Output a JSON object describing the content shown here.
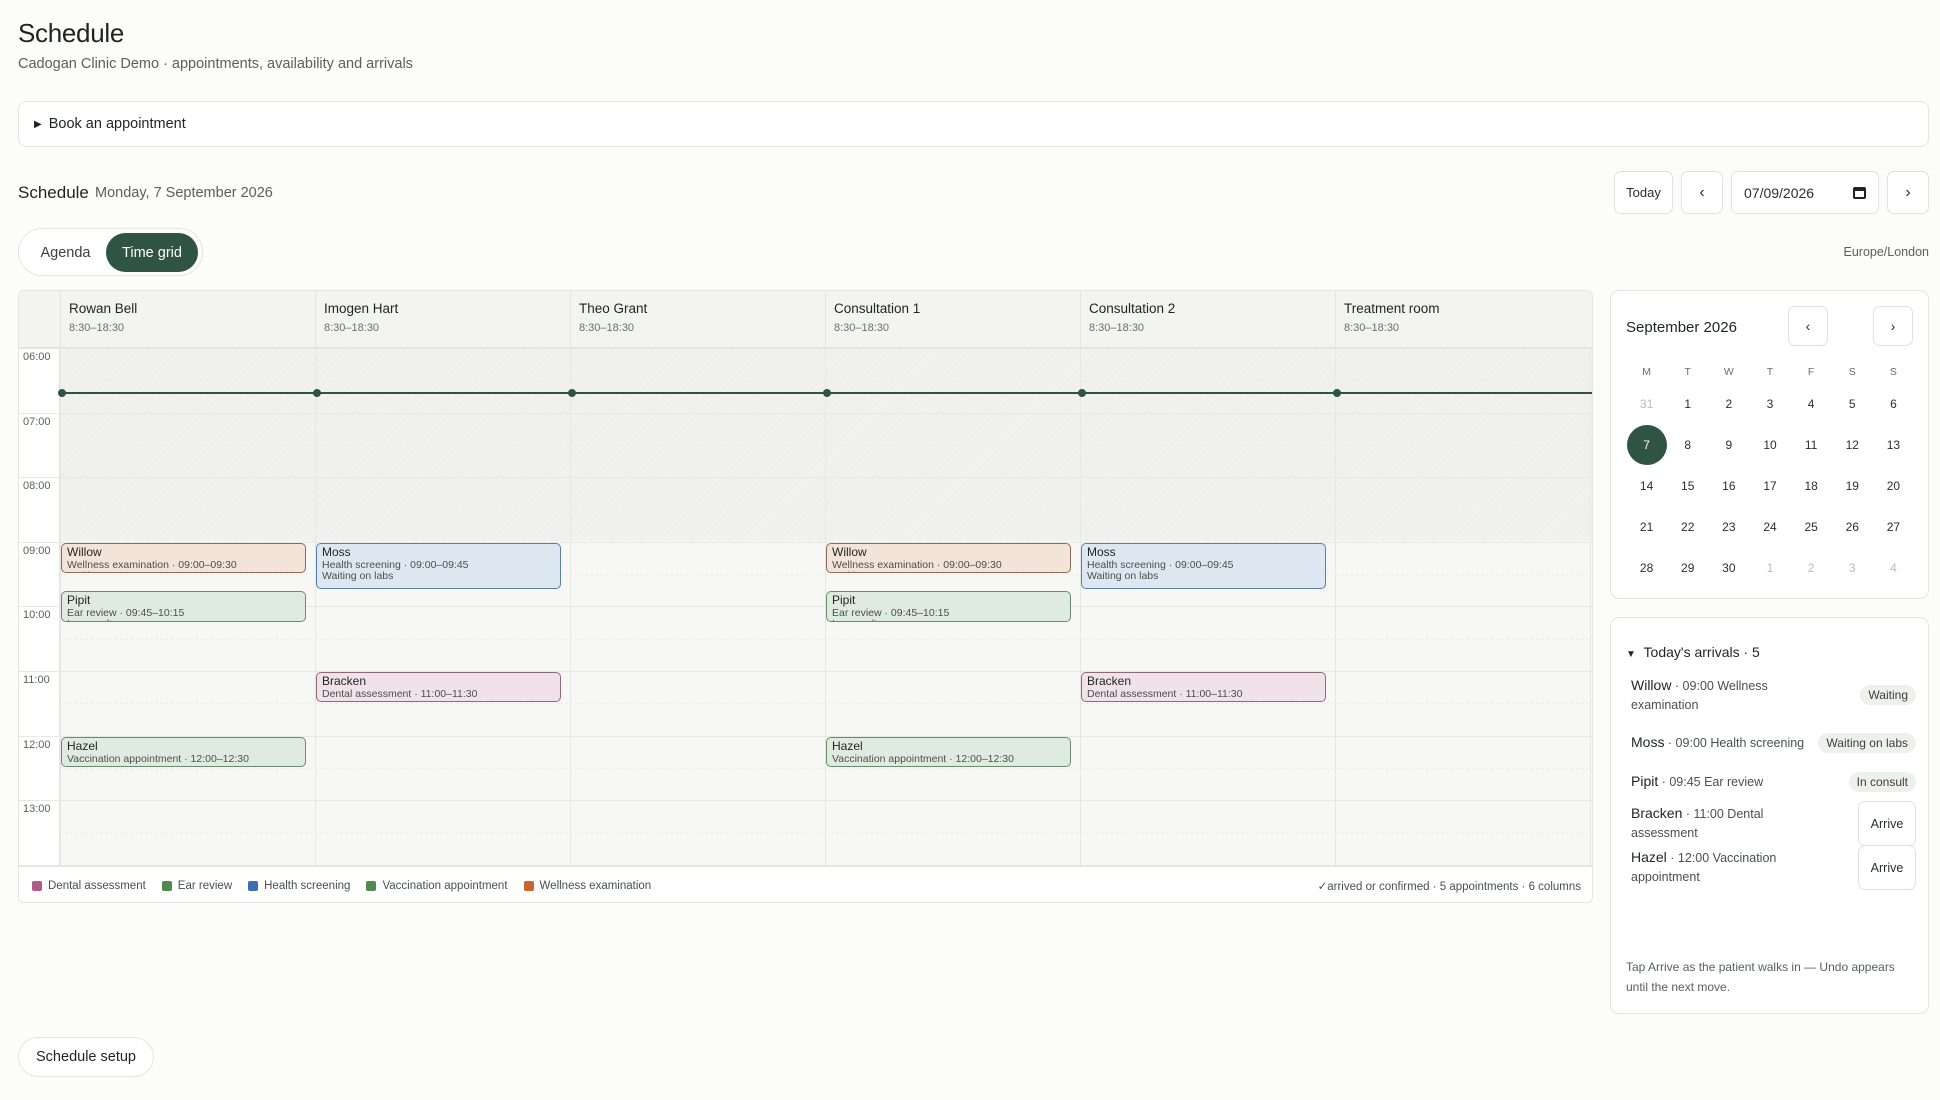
{
  "page": {
    "title": "Schedule",
    "subtitle": "Cadogan Clinic Demo · appointments, availability and arrivals"
  },
  "book": {
    "label": "Book an appointment"
  },
  "schedule": {
    "title": "Schedule",
    "date_label": "Monday, 7 September 2026",
    "timezone": "Europe/London"
  },
  "toolbar": {
    "today": "Today",
    "prev": "‹",
    "next": "›",
    "date_value": "07/09/2026"
  },
  "views": {
    "agenda": "Agenda",
    "time_grid": "Time grid",
    "active": "Time grid"
  },
  "columns": [
    {
      "name": "Rowan Bell",
      "hours": "8:30–18:30"
    },
    {
      "name": "Imogen Hart",
      "hours": "8:30–18:30"
    },
    {
      "name": "Theo Grant",
      "hours": "8:30–18:30"
    },
    {
      "name": "Consultation 1",
      "hours": "8:30–18:30"
    },
    {
      "name": "Consultation 2",
      "hours": "8:30–18:30"
    },
    {
      "name": "Treatment room",
      "hours": "8:30–18:30"
    }
  ],
  "hours": [
    "06:00",
    "07:00",
    "08:00",
    "09:00",
    "10:00",
    "11:00",
    "12:00",
    "13:00"
  ],
  "appointments": [
    {
      "column": 0,
      "name": "Willow",
      "detail": "Wellness examination · 09:00–09:30",
      "note": "Waiting",
      "start": "09:00",
      "end": "09:30",
      "type": "well"
    },
    {
      "column": 0,
      "name": "Pipit",
      "detail": "Ear review · 09:45–10:15",
      "note": "In consult",
      "start": "09:45",
      "end": "10:15",
      "type": "ear"
    },
    {
      "column": 0,
      "name": "Hazel",
      "detail": "Vaccination appointment · 12:00–12:30",
      "note": "",
      "start": "12:00",
      "end": "12:30",
      "type": "vacc"
    },
    {
      "column": 1,
      "name": "Moss",
      "detail": "Health screening · 09:00–09:45",
      "note": "Waiting on labs",
      "start": "09:00",
      "end": "09:45",
      "type": "health"
    },
    {
      "column": 1,
      "name": "Bracken",
      "detail": "Dental assessment · 11:00–11:30",
      "note": "",
      "start": "11:00",
      "end": "11:30",
      "type": "dental"
    },
    {
      "column": 3,
      "name": "Willow",
      "detail": "Wellness examination · 09:00–09:30",
      "note": "Waiting",
      "start": "09:00",
      "end": "09:30",
      "type": "well"
    },
    {
      "column": 3,
      "name": "Pipit",
      "detail": "Ear review · 09:45–10:15",
      "note": "In consult",
      "start": "09:45",
      "end": "10:15",
      "type": "ear"
    },
    {
      "column": 3,
      "name": "Hazel",
      "detail": "Vaccination appointment · 12:00–12:30",
      "note": "",
      "start": "12:00",
      "end": "12:30",
      "type": "vacc"
    },
    {
      "column": 4,
      "name": "Moss",
      "detail": "Health screening · 09:00–09:45",
      "note": "Waiting on labs",
      "start": "09:00",
      "end": "09:45",
      "type": "health"
    },
    {
      "column": 4,
      "name": "Bracken",
      "detail": "Dental assessment · 11:00–11:30",
      "note": "",
      "start": "11:00",
      "end": "11:30",
      "type": "dental"
    }
  ],
  "legend": {
    "items": [
      {
        "label": "Dental assessment",
        "color": "#b05a87"
      },
      {
        "label": "Ear review",
        "color": "#4f8a4f"
      },
      {
        "label": "Health screening",
        "color": "#3d6fb0"
      },
      {
        "label": "Vaccination appointment",
        "color": "#4f8a4f"
      },
      {
        "label": "Wellness examination",
        "color": "#c8642e"
      }
    ],
    "summary": "✓arrived or confirmed · 5 appointments · 6 columns"
  },
  "mini_calendar": {
    "title": "September 2026",
    "prev": "‹",
    "next": "›",
    "dow": [
      "M",
      "T",
      "W",
      "T",
      "F",
      "S",
      "S"
    ],
    "days": [
      {
        "d": "31",
        "m": true
      },
      {
        "d": "1"
      },
      {
        "d": "2"
      },
      {
        "d": "3"
      },
      {
        "d": "4"
      },
      {
        "d": "5"
      },
      {
        "d": "6"
      },
      {
        "d": "7",
        "sel": true
      },
      {
        "d": "8"
      },
      {
        "d": "9"
      },
      {
        "d": "10"
      },
      {
        "d": "11"
      },
      {
        "d": "12"
      },
      {
        "d": "13"
      },
      {
        "d": "14"
      },
      {
        "d": "15"
      },
      {
        "d": "16"
      },
      {
        "d": "17"
      },
      {
        "d": "18"
      },
      {
        "d": "19"
      },
      {
        "d": "20"
      },
      {
        "d": "21"
      },
      {
        "d": "22"
      },
      {
        "d": "23"
      },
      {
        "d": "24"
      },
      {
        "d": "25"
      },
      {
        "d": "26"
      },
      {
        "d": "27"
      },
      {
        "d": "28"
      },
      {
        "d": "29"
      },
      {
        "d": "30"
      },
      {
        "d": "1",
        "m": true
      },
      {
        "d": "2",
        "m": true
      },
      {
        "d": "3",
        "m": true
      },
      {
        "d": "4",
        "m": true
      }
    ]
  },
  "arrivals": {
    "title": "Today's arrivals · 5",
    "items": [
      {
        "name": "Willow",
        "detail": " · 09:00 Wellness examination",
        "status": "Waiting"
      },
      {
        "name": "Moss",
        "detail": " · 09:00 Health screening",
        "status": "Waiting on labs"
      },
      {
        "name": "Pipit",
        "detail": " · 09:45 Ear review",
        "status": "In consult"
      },
      {
        "name": "Bracken",
        "detail": " · 11:00 Dental assessment",
        "action": "Arrive"
      },
      {
        "name": "Hazel",
        "detail": " · 12:00 Vaccination appointment",
        "action": "Arrive"
      }
    ],
    "note": "Tap Arrive as the patient walks in — Undo appears until the next move."
  },
  "footer": {
    "setup_label": "Schedule setup"
  }
}
